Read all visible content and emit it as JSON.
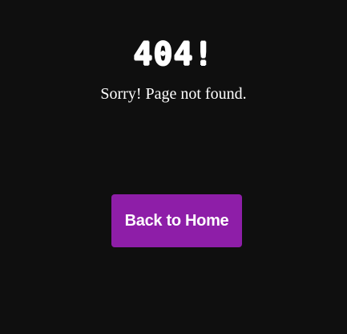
{
  "error": {
    "code_title": "404!",
    "message": "Sorry! Page not found."
  },
  "actions": {
    "home_button_label": "Back to Home"
  },
  "colors": {
    "background": "#0f0f0f",
    "text": "#ffffff",
    "button_background": "#8e1ea8"
  }
}
